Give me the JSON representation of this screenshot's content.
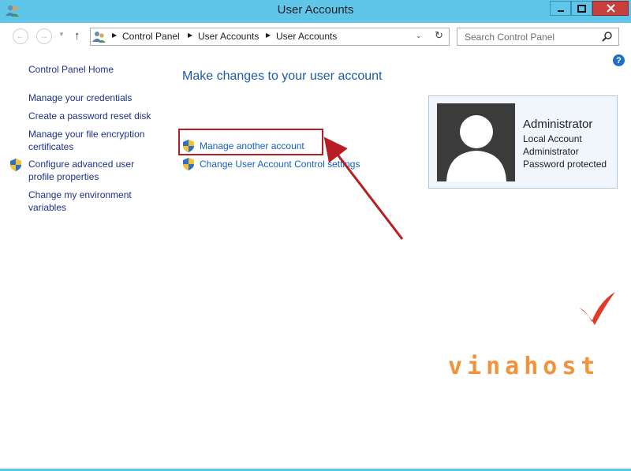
{
  "window": {
    "title": "User Accounts"
  },
  "address": {
    "crumbs": [
      "Control Panel",
      "User Accounts",
      "User Accounts"
    ]
  },
  "search": {
    "placeholder": "Search Control Panel"
  },
  "sidebar": {
    "items": [
      {
        "label": "Control Panel Home"
      },
      {
        "label": "Manage your credentials"
      },
      {
        "label": "Create a password reset disk"
      },
      {
        "label": "Manage your file encryption certificates"
      },
      {
        "label": "Configure advanced user profile properties"
      },
      {
        "label": "Change my environment variables"
      }
    ]
  },
  "main": {
    "heading": "Make changes to your user account",
    "tasks": [
      {
        "label": "Manage another account"
      },
      {
        "label": "Change User Account Control settings"
      }
    ]
  },
  "account": {
    "name": "Administrator",
    "type": "Local Account",
    "group": "Administrator",
    "status": "Password protected"
  },
  "watermark": {
    "text": "vinahost"
  },
  "colors": {
    "window_frame": "#5fc6ea",
    "link": "#1660c0",
    "highlight": "#b81d24",
    "logo": "#f3923b"
  }
}
